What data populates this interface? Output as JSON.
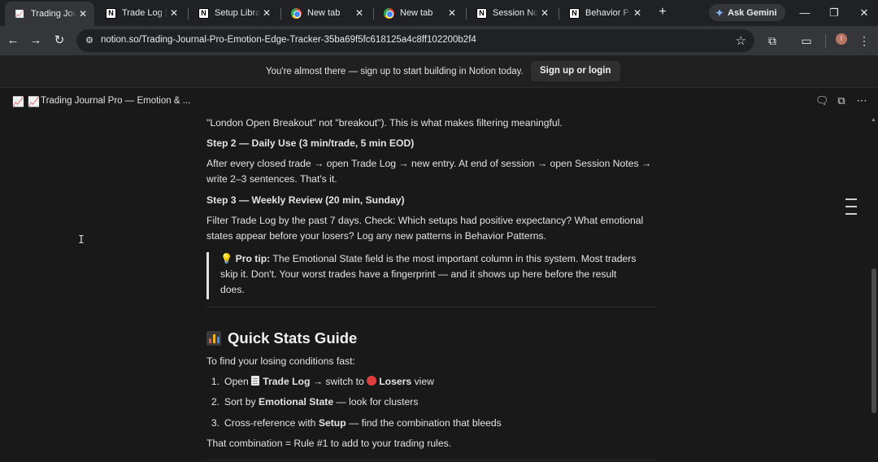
{
  "browser": {
    "tabs": [
      {
        "label": "Trading Journal",
        "icon": "chart-icon",
        "active": true
      },
      {
        "label": "Trade Log | Data",
        "icon": "notion-icon",
        "active": false
      },
      {
        "label": "Setup Library",
        "icon": "notion-icon",
        "active": false
      },
      {
        "label": "New tab",
        "icon": "chrome-icon",
        "active": false
      },
      {
        "label": "New tab",
        "icon": "chrome-icon",
        "active": false
      },
      {
        "label": "Session Notes",
        "icon": "notion-icon",
        "active": false
      },
      {
        "label": "Behavior Patterns",
        "icon": "notion-icon",
        "active": false
      }
    ],
    "new_tab_icon": "+",
    "ask_gemini": "Ask Gemini",
    "url": "notion.so/Trading-Journal-Pro-Emotion-Edge-Tracker-35ba69f5fc618125a4c8ff102200b2f4",
    "profile_initial": "I"
  },
  "banner": {
    "message": "You're almost there — sign up to start building in Notion today.",
    "signup_label": "Sign up or login"
  },
  "page": {
    "title": "Trading Journal Pro — Emotion & ..."
  },
  "content": {
    "line1": "\"London Open Breakout\" not \"breakout\"). This is what makes filtering meaningful.",
    "step2_heading": "Step 2 — Daily Use (3 min/trade, 5 min EOD)",
    "step2_line1": "After every closed trade → open Trade Log → new entry. At end of session → open Session Notes →",
    "step2_line2": "write 2–3 sentences. That's it.",
    "step3_heading": "Step 3 — Weekly Review (20 min, Sunday)",
    "step3_line1": "Filter Trade Log by the past 7 days. Check: Which setups had positive expectancy? What emotional",
    "step3_line2": "states appear before your losers? Log any new patterns in Behavior Patterns.",
    "callout_icon": "💡",
    "callout_bold": "Pro tip:",
    "callout_line1": " The Emotional State field is the most important column in this system. Most traders",
    "callout_line2": "skip it. Don't. Your worst trades have a fingerprint — and it shows up here before the result",
    "callout_line3": "does.",
    "quick_stats_heading": "Quick Stats Guide",
    "quick_stats_intro": "To find your losing conditions fast:",
    "list": [
      {
        "num": "1.",
        "pre": "Open ",
        "db": "Trade Log",
        "mid": " → switch to ",
        "view": "Losers",
        "post": " view"
      },
      {
        "num": "2.",
        "pre": "Sort by ",
        "bold": "Emotional State",
        "post": " — look for clusters"
      },
      {
        "num": "3.",
        "pre": "Cross-reference with ",
        "bold": "Setup",
        "post": " — find the combination that bleeds"
      }
    ],
    "closing": "That combination = Rule #1 to add to your trading rules."
  }
}
